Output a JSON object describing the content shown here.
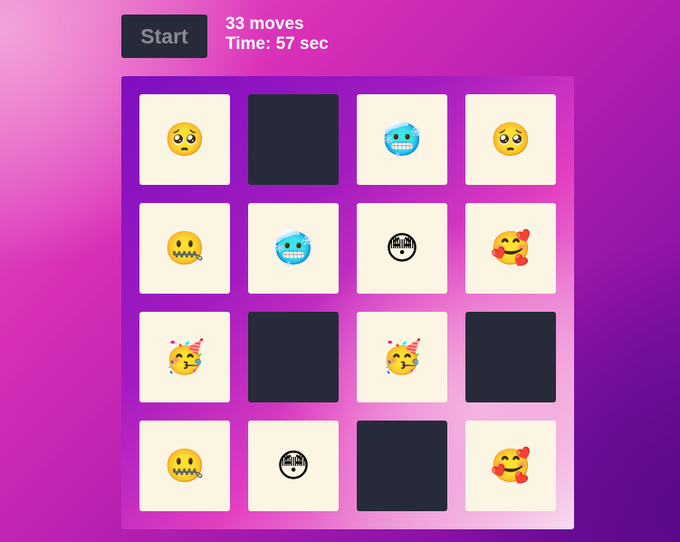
{
  "controls": {
    "start_label": "Start"
  },
  "stats": {
    "moves_text": "33 moves",
    "time_text": "Time: 57 sec"
  },
  "board": {
    "rows": 4,
    "cols": 4,
    "cards": [
      {
        "state": "up",
        "emoji": "🥺",
        "icon": "pleading-face-icon"
      },
      {
        "state": "down",
        "emoji": "",
        "icon": ""
      },
      {
        "state": "up",
        "emoji": "🥶",
        "icon": "cold-face-icon"
      },
      {
        "state": "up",
        "emoji": "🥺",
        "icon": "pleading-face-icon"
      },
      {
        "state": "up",
        "emoji": "🤐",
        "icon": "zipper-mouth-face-icon"
      },
      {
        "state": "up",
        "emoji": "🥶",
        "icon": "cold-face-icon"
      },
      {
        "state": "up",
        "emoji": "😳",
        "icon": "flushed-face-icon"
      },
      {
        "state": "up",
        "emoji": "🥰",
        "icon": "blowing-kiss-face-icon"
      },
      {
        "state": "up",
        "emoji": "🥳",
        "icon": "partying-face-icon"
      },
      {
        "state": "down",
        "emoji": "",
        "icon": ""
      },
      {
        "state": "up",
        "emoji": "🥳",
        "icon": "partying-face-icon"
      },
      {
        "state": "down",
        "emoji": "",
        "icon": ""
      },
      {
        "state": "up",
        "emoji": "🤐",
        "icon": "zipper-mouth-face-icon"
      },
      {
        "state": "up",
        "emoji": "😳",
        "icon": "flushed-face-icon"
      },
      {
        "state": "down",
        "emoji": "",
        "icon": ""
      },
      {
        "state": "up",
        "emoji": "🥰",
        "icon": "blowing-kiss-face-icon"
      }
    ],
    "colors": {
      "card_face": "#fdf5e4",
      "card_back": "#272b39"
    }
  }
}
